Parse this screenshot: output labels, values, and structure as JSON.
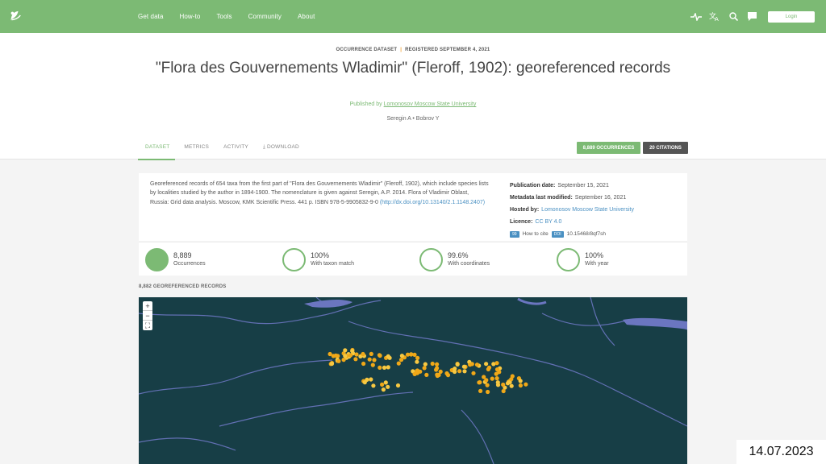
{
  "nav": {
    "items": [
      "Get data",
      "How-to",
      "Tools",
      "Community",
      "About"
    ],
    "login_label": "Login",
    "icons": [
      "activity-icon",
      "translate-icon",
      "search-icon",
      "chat-icon"
    ]
  },
  "header": {
    "kicker_type": "OCCURRENCE DATASET",
    "kicker_registered": "REGISTERED SEPTEMBER 4, 2021",
    "title": "\"Flora des Gouvernements Wladimir\" (Fleroff, 1902): georeferenced records",
    "published_by_prefix": "Published by",
    "publisher": "Lomonosov Moscow State University",
    "authors": "Seregin A • Bobrov Y",
    "tabs": [
      "DATASET",
      "METRICS",
      "ACTIVITY",
      "DOWNLOAD"
    ],
    "occurrences_badge": "8,889 OCCURRENCES",
    "citations_badge": "20 CITATIONS"
  },
  "description": {
    "text": "Georeferenced records of 654 taxa from the first part of \"Flora des Gouvernements Wladimir\" (Fleroff, 1902), which include species lists by localities studied by the author in 1894-1900. The nomenclature is given against Seregin, A.P. 2014. Flora of Vladimir Oblast, Russia: Grid data analysis. Moscow, KMK Scientific Press. 441 p. ISBN 978-5-9905832-9-0 ",
    "link": "(http://dx.doi.org/10.13140/2.1.1148.2407)"
  },
  "meta": {
    "publication_label": "Publication date:",
    "publication_value": "September 15, 2021",
    "modified_label": "Metadata last modified:",
    "modified_value": "September 16, 2021",
    "hosted_label": "Hosted by:",
    "hosted_value": "Lomonosov Moscow State University",
    "licence_label": "Licence:",
    "licence_value": "CC BY 4.0",
    "cite_icon": "99",
    "cite_label": "How to cite",
    "doi_badge": "DOI",
    "doi_value": "10.15468/8qf7sh"
  },
  "stats": [
    {
      "value": "8,889",
      "label": "Occurrences",
      "fill": 1.0
    },
    {
      "value": "100%",
      "label": "With taxon match",
      "fill": 1.0
    },
    {
      "value": "99.6%",
      "label": "With coordinates",
      "fill": 0.996
    },
    {
      "value": "100%",
      "label": "With year",
      "fill": 1.0
    }
  ],
  "map": {
    "label": "8,882 GEOREFERENCED RECORDS",
    "zoom_in": "+",
    "zoom_out": "−",
    "fullscreen": "⛶",
    "background": "#173e46",
    "point_color": "#f0a818"
  },
  "stamp": "14.07.2023",
  "colors": {
    "accent": "#7cba74",
    "link": "#4a90c2"
  }
}
